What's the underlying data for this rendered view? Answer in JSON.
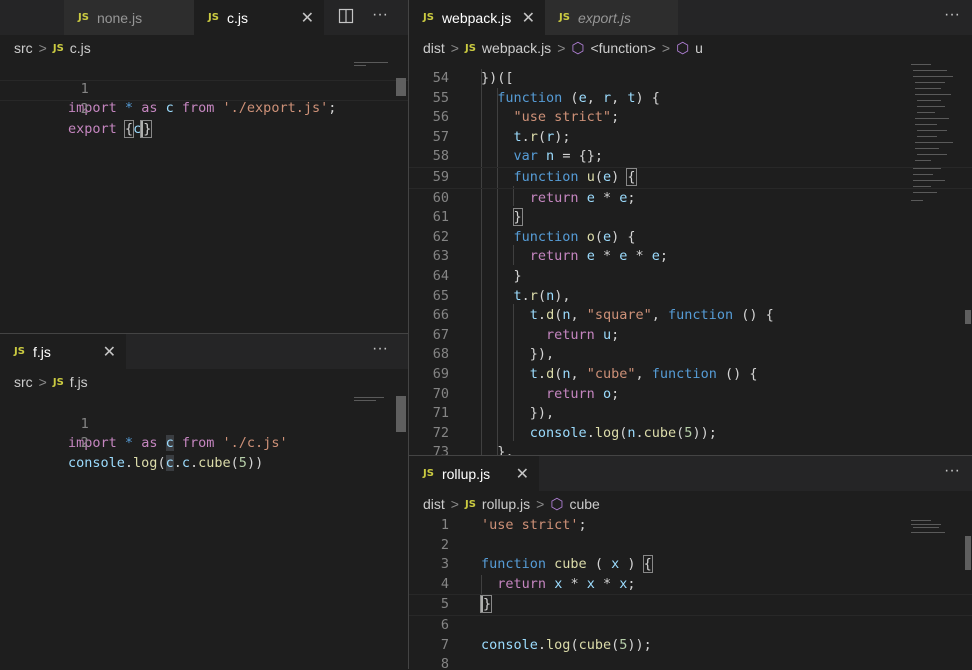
{
  "left_top": {
    "tabs": [
      {
        "label": "none.js",
        "active": false
      },
      {
        "label": "c.js",
        "active": true
      }
    ],
    "breadcrumb": {
      "folder": "src",
      "file": "c.js"
    },
    "lines": [
      {
        "num": "1",
        "text": "import * as c from './export.js';"
      },
      {
        "num": "2",
        "text": "export {c}"
      }
    ]
  },
  "left_bottom": {
    "tabs": [
      {
        "label": "f.js",
        "active": true
      }
    ],
    "breadcrumb": {
      "folder": "src",
      "file": "f.js"
    },
    "lines": [
      {
        "num": "1",
        "text": "import * as c from './c.js'"
      },
      {
        "num": "2",
        "text": "console.log(c.c.cube(5))"
      }
    ]
  },
  "right_top": {
    "tabs": [
      {
        "label": "webpack.js",
        "active": true
      },
      {
        "label": "export.js",
        "active": false
      }
    ],
    "breadcrumb": {
      "folder": "dist",
      "file": "webpack.js",
      "symbol1": "<function>",
      "symbol2": "u"
    },
    "lines": [
      {
        "num": "54",
        "text": "})(["
      },
      {
        "num": "55",
        "text": "  function (e, r, t) {"
      },
      {
        "num": "56",
        "text": "    \"use strict\";"
      },
      {
        "num": "57",
        "text": "    t.r(r);"
      },
      {
        "num": "58",
        "text": "    var n = {};"
      },
      {
        "num": "59",
        "text": "    function u(e) {"
      },
      {
        "num": "60",
        "text": "      return e * e;"
      },
      {
        "num": "61",
        "text": "    }"
      },
      {
        "num": "62",
        "text": "    function o(e) {"
      },
      {
        "num": "63",
        "text": "      return e * e * e;"
      },
      {
        "num": "64",
        "text": "    }"
      },
      {
        "num": "65",
        "text": "    t.r(n),"
      },
      {
        "num": "66",
        "text": "      t.d(n, \"square\", function () {"
      },
      {
        "num": "67",
        "text": "        return u;"
      },
      {
        "num": "68",
        "text": "      }),"
      },
      {
        "num": "69",
        "text": "      t.d(n, \"cube\", function () {"
      },
      {
        "num": "70",
        "text": "        return o;"
      },
      {
        "num": "71",
        "text": "      }),"
      },
      {
        "num": "72",
        "text": "      console.log(n.cube(5));"
      },
      {
        "num": "73",
        "text": "  },"
      }
    ]
  },
  "right_bottom": {
    "tabs": [
      {
        "label": "rollup.js",
        "active": true
      }
    ],
    "breadcrumb": {
      "folder": "dist",
      "file": "rollup.js",
      "symbol": "cube"
    },
    "lines": [
      {
        "num": "1",
        "text": "'use strict';"
      },
      {
        "num": "2",
        "text": ""
      },
      {
        "num": "3",
        "text": "function cube ( x ) {"
      },
      {
        "num": "4",
        "text": "  return x * x * x;"
      },
      {
        "num": "5",
        "text": "}"
      },
      {
        "num": "6",
        "text": ""
      },
      {
        "num": "7",
        "text": "console.log(cube(5));"
      },
      {
        "num": "8",
        "text": ""
      }
    ]
  },
  "icons": {
    "split": "split-editor-icon",
    "more": "more-actions-icon",
    "close": "close-icon",
    "symbol": "symbol-cube-icon",
    "js": "js-file-icon"
  },
  "js_badge": "JS",
  "colors": {
    "background": "#1e1e1e",
    "tabbar": "#252526",
    "keyword": "#c586c0",
    "string": "#ce9178",
    "function": "#dcdcaa"
  }
}
